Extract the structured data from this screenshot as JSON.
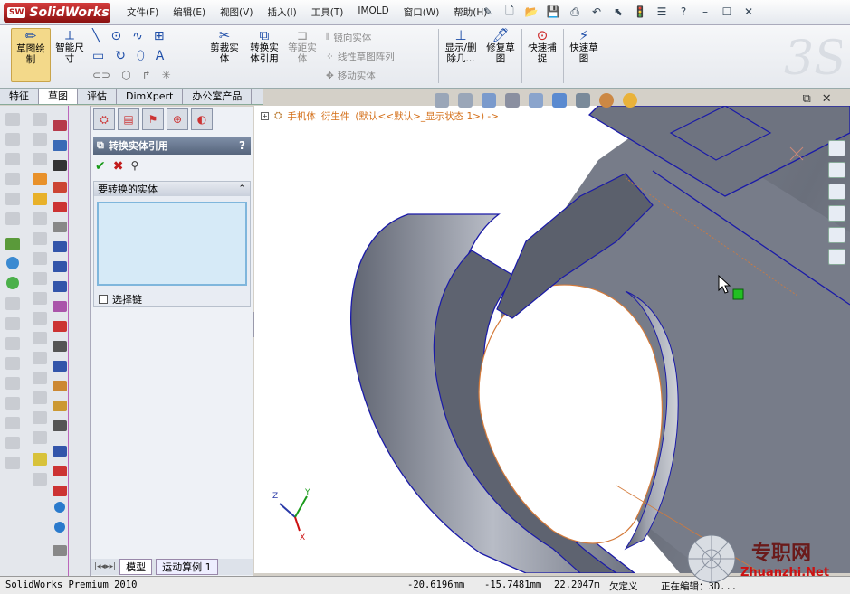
{
  "app": {
    "logo": "SolidWorks",
    "logo_badge": "SW"
  },
  "menu": [
    "文件(F)",
    "编辑(E)",
    "视图(V)",
    "插入(I)",
    "工具(T)",
    "IMOLD",
    "窗口(W)",
    "帮助(H)"
  ],
  "ribbon": {
    "sketch": "草图绘\n制",
    "smart_dim": "智能尺\n寸",
    "trim": "剪裁实\n体",
    "convert": "转换实\n体引用",
    "offset": "等距实\n体",
    "mirror": "镜向实体",
    "linear_pattern": "线性草图阵列",
    "move": "移动实体",
    "show_delete": "显示/删\n除几...",
    "repair": "修复草\n图",
    "quick_snap": "快速捕\n捉",
    "rapid_sketch": "快速草\n图"
  },
  "tabs": [
    "特征",
    "草图",
    "评估",
    "DimXpert",
    "办公室产品"
  ],
  "tree": {
    "part": "手机体",
    "derived": "衍生件",
    "config": "(默认<<默认>_显示状态 1>) ->"
  },
  "pm": {
    "title": "转换实体引用",
    "help": "?",
    "group_title": "要转换的实体",
    "select_chain": "选择链",
    "bottom_tabs": [
      "模型",
      "运动算例 1"
    ]
  },
  "status": {
    "product": "SolidWorks Premium 2010",
    "x": "-20.6196mm",
    "y": "-15.7481mm",
    "z": "22.2047m",
    "defined": "欠定义",
    "editing": "正在编辑：3D..."
  },
  "watermark": {
    "title": "专职网",
    "url": "Zhuanzhi.Net"
  },
  "colors": {
    "accent": "#1e4ea8",
    "edge": "#1a1aa8",
    "face": "#7a7f8c"
  }
}
